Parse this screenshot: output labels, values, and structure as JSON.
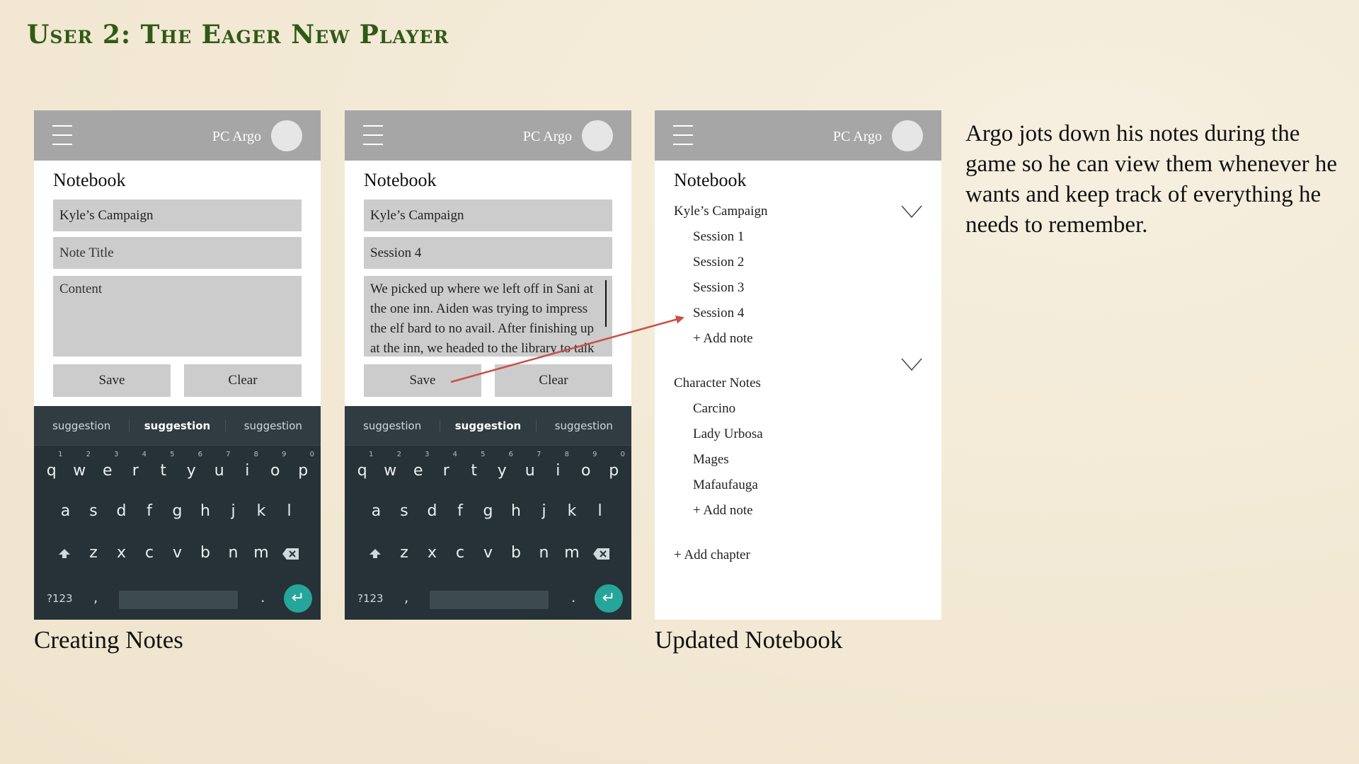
{
  "slide": {
    "title": "User 2: The Eager New Player",
    "description": "Argo jots down his notes during the game so he can view them whenever he wants and keep track of everything he needs to remember.",
    "accent_color": "#2f5a14",
    "arrow_color": "#c9504b"
  },
  "header": {
    "pc_label": "PC Argo",
    "menu_icon": "hamburger-icon",
    "avatar_icon": "avatar-circle"
  },
  "screen1": {
    "notebook_title": "Notebook",
    "campaign_value": "Kyle’s Campaign",
    "note_title_placeholder": "Note Title",
    "content_placeholder": "Content",
    "save_label": "Save",
    "clear_label": "Clear",
    "caption": "Creating Notes"
  },
  "screen2": {
    "notebook_title": "Notebook",
    "campaign_value": "Kyle’s Campaign",
    "note_title_value": "Session 4",
    "content_value": "We picked up where we left off in Sani at the one inn. Aiden was trying to impress the elf bard to no avail. After finishing up at the inn, we headed to the library to talk",
    "save_label": "Save",
    "clear_label": "Clear"
  },
  "keyboard": {
    "suggestions": [
      "suggestion",
      "suggestion",
      "suggestion"
    ],
    "row1": [
      "q",
      "w",
      "e",
      "r",
      "t",
      "y",
      "u",
      "i",
      "o",
      "p"
    ],
    "row1_nums": [
      "1",
      "2",
      "3",
      "4",
      "5",
      "6",
      "7",
      "8",
      "9",
      "0"
    ],
    "row2": [
      "a",
      "s",
      "d",
      "f",
      "g",
      "h",
      "j",
      "k",
      "l"
    ],
    "row3": [
      "z",
      "x",
      "c",
      "v",
      "b",
      "n",
      "m"
    ],
    "symbols_label": "?123",
    "comma": ",",
    "period": ".",
    "shift_icon": "shift-icon",
    "backspace_icon": "backspace-icon",
    "enter_icon": "enter-icon"
  },
  "screen3": {
    "notebook_title": "Notebook",
    "chapters": [
      {
        "name": "Kyle’s Campaign",
        "notes": [
          "Session 1",
          "Session 2",
          "Session 3",
          "Session 4"
        ],
        "add_note": "+ Add note"
      },
      {
        "name": "Character Notes",
        "notes": [
          "Carcino",
          "Lady Urbosa",
          "Mages",
          "Mafaufauga"
        ],
        "add_note": "+ Add note"
      }
    ],
    "add_chapter": "+ Add chapter",
    "caption": "Updated Notebook"
  }
}
